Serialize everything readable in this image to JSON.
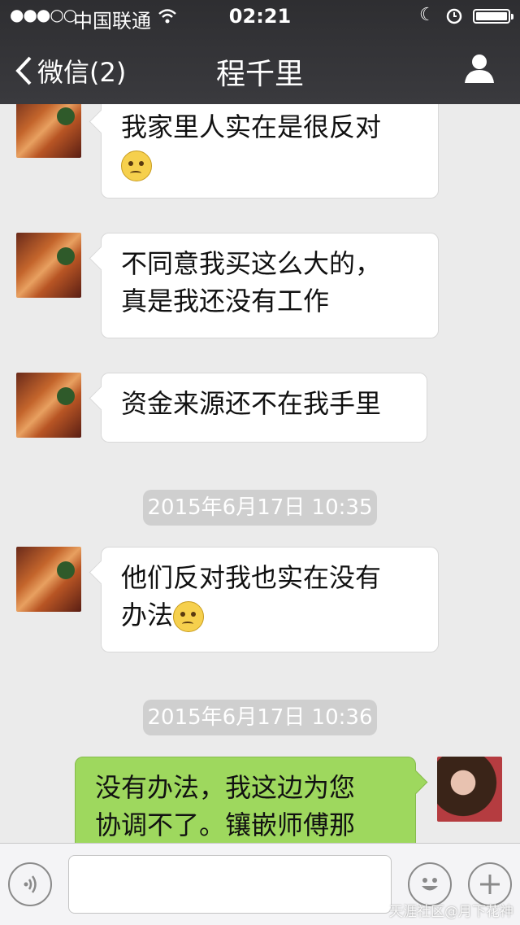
{
  "status_bar": {
    "signal": "●●●○○",
    "carrier": "中国联通",
    "time": "02:21"
  },
  "nav": {
    "back_label": "微信(2)",
    "title": "程千里"
  },
  "messages": [
    {
      "side": "left",
      "lines": [
        "我家里人实在是很反对"
      ],
      "emoji_after": true
    },
    {
      "side": "left",
      "lines": [
        "不同意我买这么大的，",
        "真是我还没有工作"
      ],
      "emoji_after": false
    },
    {
      "side": "left",
      "lines": [
        "资金来源还不在我手里"
      ],
      "emoji_after": false
    },
    {
      "side": "left",
      "lines": [
        "他们反对我也实在没有",
        "办法"
      ],
      "emoji_after": true
    },
    {
      "side": "right",
      "lines": [
        "没有办法，我这边为您",
        "协调不了。镶嵌师傅那"
      ],
      "emoji_after": false
    }
  ],
  "timestamps": [
    "2015年6月17日 10:35",
    "2015年6月17日 10:36"
  ],
  "input": {
    "placeholder": ""
  },
  "watermark": "天涯社区@月下花神",
  "icons": {
    "back": "chevron-left-icon",
    "profile": "person-icon",
    "voice": "voice-icon",
    "emoji": "smiley-icon",
    "more": "plus-icon"
  },
  "colors": {
    "header_bg": "#2e2e31",
    "chat_bg": "#ebebeb",
    "bubble_in": "#ffffff",
    "bubble_out": "#9ed85e",
    "timestamp_bg": "#cfcfcf"
  }
}
